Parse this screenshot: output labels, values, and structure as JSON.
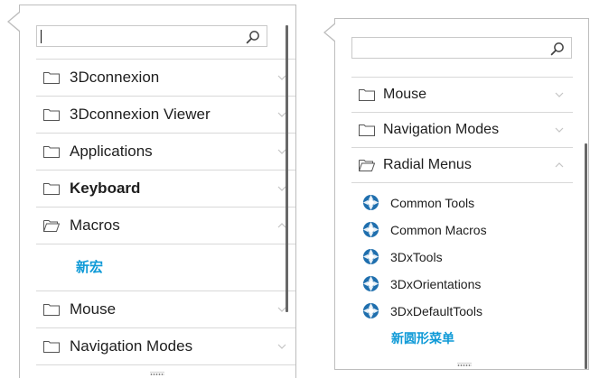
{
  "left_panel": {
    "search": {
      "value": "",
      "placeholder": ""
    },
    "items": [
      {
        "label": "3Dconnexion",
        "expanded": false
      },
      {
        "label": "3Dconnexion Viewer",
        "expanded": false
      },
      {
        "label": "Applications",
        "expanded": false
      },
      {
        "label": "Keyboard",
        "expanded": false,
        "bold": true
      },
      {
        "label": "Macros",
        "expanded": true
      },
      {
        "label": "Mouse",
        "expanded": false
      },
      {
        "label": "Navigation Modes",
        "expanded": false
      }
    ],
    "macros_new_label": "新宏"
  },
  "right_panel": {
    "search": {
      "value": "",
      "placeholder": ""
    },
    "items": [
      {
        "label": "Mouse",
        "expanded": false
      },
      {
        "label": "Navigation Modes",
        "expanded": false
      },
      {
        "label": "Radial Menus",
        "expanded": true
      }
    ],
    "radial_menus": [
      {
        "label": "Common Tools"
      },
      {
        "label": "Common Macros"
      },
      {
        "label": "3DxTools"
      },
      {
        "label": "3DxOrientations"
      },
      {
        "label": "3DxDefaultTools"
      }
    ],
    "radial_new_label": "新圆形菜单"
  },
  "icons": {
    "folder": "folder-icon",
    "folder_open": "folder-open-icon",
    "search": "search-icon",
    "chevron_down": "chevron-down-icon",
    "chevron_up": "chevron-up-icon",
    "radial_menu": "radial-menu-icon"
  },
  "colors": {
    "accent": "#0f9ad7",
    "radial_icon_blue": "#1f6fae",
    "text": "#1e1e1e",
    "divider": "#d8d8d8",
    "border": "#bdbdbd"
  }
}
